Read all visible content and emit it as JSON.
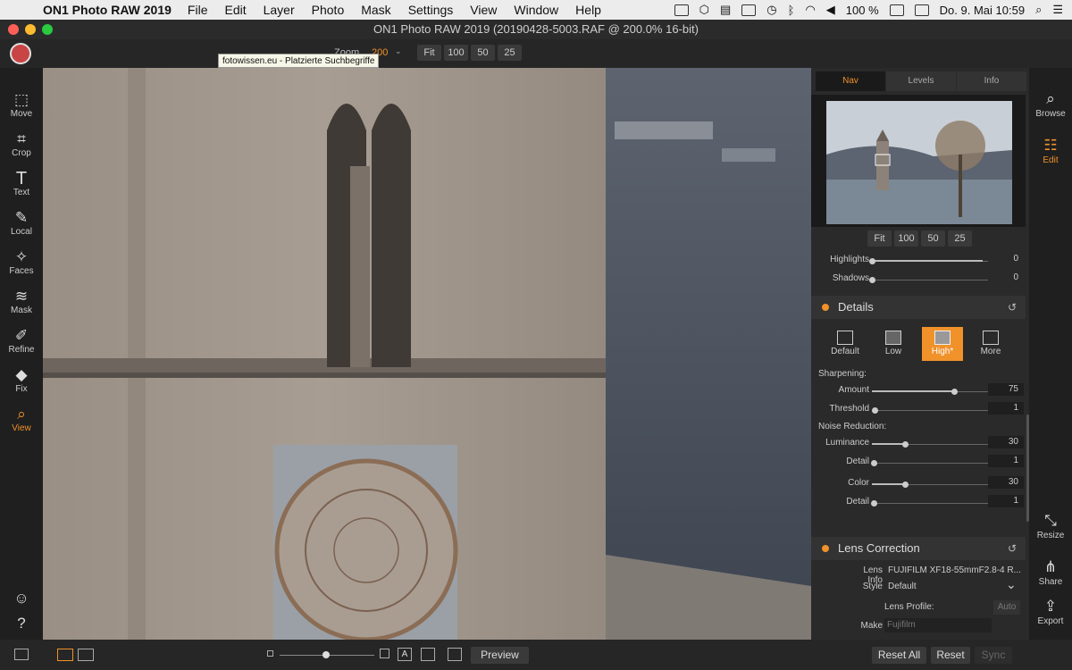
{
  "menubar": {
    "app_name": "ON1 Photo RAW 2019",
    "items": [
      "File",
      "Edit",
      "Layer",
      "Photo",
      "Mask",
      "Settings",
      "View",
      "Window",
      "Help"
    ],
    "battery": "100 %",
    "datetime": "Do. 9. Mai  10:59"
  },
  "window": {
    "title": "ON1 Photo RAW 2019 (20190428-5003.RAF @ 200.0% 16-bit)"
  },
  "toolbar": {
    "zoom_label": "Zoom",
    "zoom_value": "200",
    "zoom_buttons": [
      "Fit",
      "100",
      "50",
      "25"
    ],
    "tooltip": "fotowissen.eu - Platzierte Suchbegriffe"
  },
  "left_tools": [
    {
      "label": "Move",
      "icon": "move-icon"
    },
    {
      "label": "Crop",
      "icon": "crop-icon"
    },
    {
      "label": "Text",
      "icon": "text-icon"
    },
    {
      "label": "Local",
      "icon": "brush-icon"
    },
    {
      "label": "Faces",
      "icon": "faces-icon"
    },
    {
      "label": "Mask",
      "icon": "mask-icon"
    },
    {
      "label": "Refine",
      "icon": "refine-icon"
    },
    {
      "label": "Fix",
      "icon": "fix-icon"
    },
    {
      "label": "View",
      "icon": "magnifier-icon"
    }
  ],
  "right_tools": {
    "browse": "Browse",
    "edit": "Edit",
    "resize": "Resize",
    "share": "Share",
    "export": "Export"
  },
  "panel": {
    "tabs": [
      "Nav",
      "Levels",
      "Info"
    ],
    "nav_zoom_buttons": [
      "Fit",
      "100",
      "50",
      "25"
    ],
    "top_sliders": [
      {
        "label": "Highlights",
        "value": "0"
      },
      {
        "label": "Shadows",
        "value": "0"
      }
    ],
    "details": {
      "title": "Details",
      "presets": [
        "Default",
        "Low",
        "High*",
        "More"
      ],
      "sharpening_label": "Sharpening:",
      "sharpening": [
        {
          "label": "Amount",
          "value": "75"
        },
        {
          "label": "Threshold",
          "value": "1"
        }
      ],
      "noise_label": "Noise Reduction:",
      "noise": [
        {
          "label": "Luminance",
          "value": "30"
        },
        {
          "label": "Detail",
          "value": "1"
        },
        {
          "label": "Color",
          "value": "30"
        },
        {
          "label": "Detail",
          "value": "1"
        }
      ]
    },
    "lens": {
      "title": "Lens Correction",
      "lens_info_label": "Lens Info",
      "lens_info_value": "FUJIFILM XF18-55mmF2.8-4 R...",
      "style_label": "Style",
      "style_value": "Default",
      "profile_label": "Lens Profile:",
      "auto_label": "Auto",
      "make_label": "Make",
      "make_value": "Fujifilm"
    }
  },
  "bottom": {
    "preview": "Preview",
    "reset_all": "Reset All",
    "reset": "Reset",
    "sync": "Sync"
  },
  "colors": {
    "accent": "#f0912a",
    "panel_bg": "#2a2a2a"
  }
}
